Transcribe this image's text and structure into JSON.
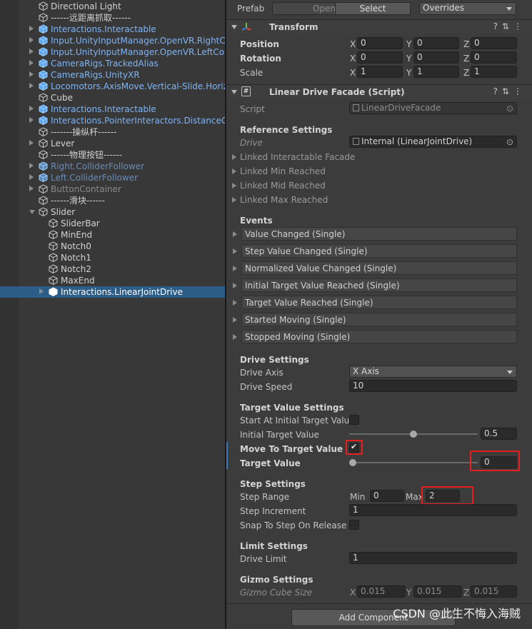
{
  "hierarchy": {
    "items": [
      {
        "label": "Directional Light",
        "kind": "go",
        "indent": 1,
        "arrow": "none",
        "color": "normal"
      },
      {
        "label": "------远距离抓取------",
        "kind": "go",
        "indent": 1,
        "arrow": "none",
        "color": "normal"
      },
      {
        "label": "Interactions.Interactable",
        "kind": "prefab",
        "indent": 1,
        "arrow": "right",
        "color": "prefab"
      },
      {
        "label": "Input.UnityInputManager.OpenVR.RightController",
        "kind": "prefab",
        "indent": 1,
        "arrow": "right",
        "color": "prefab"
      },
      {
        "label": "Input.UnityInputManager.OpenVR.LeftController",
        "kind": "prefab",
        "indent": 1,
        "arrow": "right",
        "color": "prefab"
      },
      {
        "label": "CameraRigs.TrackedAlias",
        "kind": "prefab",
        "indent": 1,
        "arrow": "right",
        "color": "prefab"
      },
      {
        "label": "CameraRigs.UnityXR",
        "kind": "prefab",
        "indent": 1,
        "arrow": "right",
        "color": "prefab"
      },
      {
        "label": "Locomotors.AxisMove.Vertical-Slide.Horizontal-Snap",
        "kind": "prefab",
        "indent": 1,
        "arrow": "right",
        "color": "prefab"
      },
      {
        "label": "Cube",
        "kind": "go",
        "indent": 1,
        "arrow": "none",
        "color": "normal"
      },
      {
        "label": "Interactions.Interactable",
        "kind": "prefab",
        "indent": 1,
        "arrow": "right",
        "color": "prefab"
      },
      {
        "label": "Interactions.PointerInteractors.DistanceGrabber",
        "kind": "prefab",
        "indent": 1,
        "arrow": "right",
        "color": "prefab"
      },
      {
        "label": "-------操纵杆------",
        "kind": "go",
        "indent": 1,
        "arrow": "none",
        "color": "normal"
      },
      {
        "label": "Lever",
        "kind": "go",
        "indent": 1,
        "arrow": "right",
        "color": "normal"
      },
      {
        "label": "------物理按钮------",
        "kind": "go",
        "indent": 1,
        "arrow": "none",
        "color": "normal"
      },
      {
        "label": "Right.ColliderFollower",
        "kind": "prefab",
        "indent": 1,
        "arrow": "right",
        "color": "prefab-dim"
      },
      {
        "label": "Left.ColliderFollower",
        "kind": "prefab",
        "indent": 1,
        "arrow": "right",
        "color": "prefab-dim"
      },
      {
        "label": "ButtonContainer",
        "kind": "go",
        "indent": 1,
        "arrow": "right",
        "color": "dim"
      },
      {
        "label": "------滑块------",
        "kind": "go",
        "indent": 1,
        "arrow": "none",
        "color": "normal"
      },
      {
        "label": "Slider",
        "kind": "go",
        "indent": 1,
        "arrow": "down",
        "color": "normal"
      },
      {
        "label": "SliderBar",
        "kind": "go",
        "indent": 2,
        "arrow": "none",
        "color": "normal"
      },
      {
        "label": "MinEnd",
        "kind": "go",
        "indent": 2,
        "arrow": "none",
        "color": "normal"
      },
      {
        "label": "Notch0",
        "kind": "go",
        "indent": 2,
        "arrow": "none",
        "color": "normal"
      },
      {
        "label": "Notch1",
        "kind": "go",
        "indent": 2,
        "arrow": "none",
        "color": "normal"
      },
      {
        "label": "Notch2",
        "kind": "go",
        "indent": 2,
        "arrow": "none",
        "color": "normal"
      },
      {
        "label": "MaxEnd",
        "kind": "go",
        "indent": 2,
        "arrow": "none",
        "color": "normal"
      },
      {
        "label": "Interactions.LinearJointDrive",
        "kind": "prefab",
        "indent": 2,
        "arrow": "right",
        "color": "prefab",
        "selected": true
      }
    ]
  },
  "prefab_bar": {
    "label": "Prefab",
    "open": "Open",
    "select": "Select",
    "overrides": "Overrides"
  },
  "transform": {
    "title": "Transform",
    "rows": [
      {
        "label": "Position",
        "x": "0",
        "y": "0",
        "z": "0"
      },
      {
        "label": "Rotation",
        "x": "0",
        "y": "0",
        "z": "0"
      },
      {
        "label": "Scale",
        "x": "1",
        "y": "1",
        "z": "1"
      }
    ],
    "axis_x": "X",
    "axis_y": "Y",
    "axis_z": "Z"
  },
  "component": {
    "title": "Linear Drive Facade (Script)",
    "script_label": "Script",
    "script_value": "LinearDriveFacade",
    "reference_header": "Reference Settings",
    "drive_label": "Drive",
    "drive_value": "Internal (LinearJointDrive)",
    "linked": [
      "Linked Interactable Facade",
      "Linked Min Reached",
      "Linked Mid Reached",
      "Linked Max Reached"
    ],
    "events_header": "Events",
    "events": [
      "Value Changed (Single)",
      "Step Value Changed (Single)",
      "Normalized Value Changed (Single)",
      "Initial Target Value Reached (Single)",
      "Target Value Reached (Single)",
      "Started Moving (Single)",
      "Stopped Moving (Single)"
    ],
    "drive_settings_header": "Drive Settings",
    "drive_axis_label": "Drive Axis",
    "drive_axis_value": "X Axis",
    "drive_speed_label": "Drive Speed",
    "drive_speed_value": "10",
    "target_header": "Target Value Settings",
    "start_at_initial_label": "Start At Initial Target Value",
    "start_at_initial_checked": false,
    "initial_target_label": "Initial Target Value",
    "initial_target_value": "0.5",
    "initial_target_fraction": 0.5,
    "move_to_target_label": "Move To Target Value",
    "move_to_target_checked": true,
    "target_value_label": "Target Value",
    "target_value_value": "0",
    "target_value_fraction": 0,
    "step_header": "Step Settings",
    "step_range_label": "Step Range",
    "min_label": "Min",
    "min_value": "0",
    "max_label": "Max",
    "max_value": "2",
    "step_increment_label": "Step Increment",
    "step_increment_value": "1",
    "snap_label": "Snap To Step On Release",
    "snap_checked": false,
    "limit_header": "Limit Settings",
    "drive_limit_label": "Drive Limit",
    "drive_limit_value": "1",
    "gizmo_header": "Gizmo Settings",
    "gizmo_label": "Gizmo Cube Size",
    "gizmo_x": "0.015",
    "gizmo_y": "0.015",
    "gizmo_z": "0.015"
  },
  "add_component": "Add Component",
  "watermark": "CSDN @此生不悔入海贼",
  "colors": {
    "selection": "#2c5d87",
    "prefab_text": "#7fb4f5",
    "highlight_box": "#e81e1e"
  }
}
